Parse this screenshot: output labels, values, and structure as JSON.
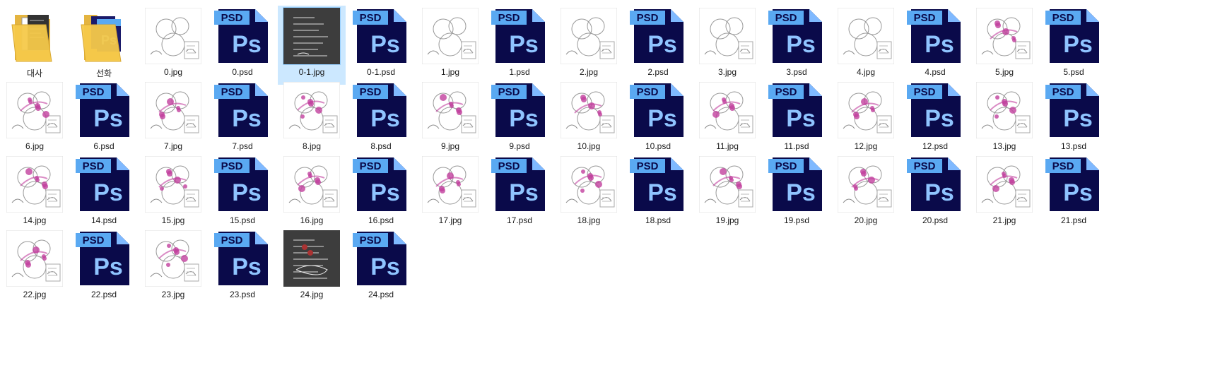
{
  "colors": {
    "selection_bg": "#cce8ff",
    "psd_dark": "#0a0a4a",
    "psd_blue": "#5aa9f2",
    "folder_yellow": "#f5c94a",
    "sketch_pink": "#c2409e"
  },
  "items": [
    {
      "name": "대사",
      "kind": "folder"
    },
    {
      "name": "선화",
      "kind": "folder"
    },
    {
      "name": "0.jpg",
      "kind": "jpg"
    },
    {
      "name": "0.psd",
      "kind": "psd"
    },
    {
      "name": "0-1.jpg",
      "kind": "jpg",
      "selected": true,
      "dark": true
    },
    {
      "name": "0-1.psd",
      "kind": "psd"
    },
    {
      "name": "1.jpg",
      "kind": "jpg"
    },
    {
      "name": "1.psd",
      "kind": "psd"
    },
    {
      "name": "2.jpg",
      "kind": "jpg"
    },
    {
      "name": "2.psd",
      "kind": "psd"
    },
    {
      "name": "3.jpg",
      "kind": "jpg"
    },
    {
      "name": "3.psd",
      "kind": "psd"
    },
    {
      "name": "4.jpg",
      "kind": "jpg"
    },
    {
      "name": "4.psd",
      "kind": "psd"
    },
    {
      "name": "5.jpg",
      "kind": "jpg",
      "pink": true
    },
    {
      "name": "5.psd",
      "kind": "psd"
    },
    {
      "name": "6.jpg",
      "kind": "jpg",
      "pink": true
    },
    {
      "name": "6.psd",
      "kind": "psd"
    },
    {
      "name": "7.jpg",
      "kind": "jpg",
      "pink": true
    },
    {
      "name": "7.psd",
      "kind": "psd"
    },
    {
      "name": "8.jpg",
      "kind": "jpg",
      "pink": true
    },
    {
      "name": "8.psd",
      "kind": "psd"
    },
    {
      "name": "9.jpg",
      "kind": "jpg",
      "pink": true
    },
    {
      "name": "9.psd",
      "kind": "psd"
    },
    {
      "name": "10.jpg",
      "kind": "jpg",
      "pink": true
    },
    {
      "name": "10.psd",
      "kind": "psd"
    },
    {
      "name": "11.jpg",
      "kind": "jpg",
      "pink": true
    },
    {
      "name": "11.psd",
      "kind": "psd"
    },
    {
      "name": "12.jpg",
      "kind": "jpg",
      "pink": true
    },
    {
      "name": "12.psd",
      "kind": "psd"
    },
    {
      "name": "13.jpg",
      "kind": "jpg",
      "pink": true
    },
    {
      "name": "13.psd",
      "kind": "psd"
    },
    {
      "name": "14.jpg",
      "kind": "jpg",
      "pink": true
    },
    {
      "name": "14.psd",
      "kind": "psd"
    },
    {
      "name": "15.jpg",
      "kind": "jpg",
      "pink": true
    },
    {
      "name": "15.psd",
      "kind": "psd"
    },
    {
      "name": "16.jpg",
      "kind": "jpg",
      "pink": true
    },
    {
      "name": "16.psd",
      "kind": "psd"
    },
    {
      "name": "17.jpg",
      "kind": "jpg",
      "pink": true
    },
    {
      "name": "17.psd",
      "kind": "psd"
    },
    {
      "name": "18.jpg",
      "kind": "jpg",
      "pink": true
    },
    {
      "name": "18.psd",
      "kind": "psd"
    },
    {
      "name": "19.jpg",
      "kind": "jpg",
      "pink": true
    },
    {
      "name": "19.psd",
      "kind": "psd"
    },
    {
      "name": "20.jpg",
      "kind": "jpg",
      "pink": true
    },
    {
      "name": "20.psd",
      "kind": "psd"
    },
    {
      "name": "21.jpg",
      "kind": "jpg",
      "pink": true
    },
    {
      "name": "21.psd",
      "kind": "psd"
    },
    {
      "name": "22.jpg",
      "kind": "jpg",
      "pink": true
    },
    {
      "name": "22.psd",
      "kind": "psd"
    },
    {
      "name": "23.jpg",
      "kind": "jpg",
      "pink": true
    },
    {
      "name": "23.psd",
      "kind": "psd"
    },
    {
      "name": "24.jpg",
      "kind": "jpg",
      "dark": true
    },
    {
      "name": "24.psd",
      "kind": "psd"
    }
  ]
}
